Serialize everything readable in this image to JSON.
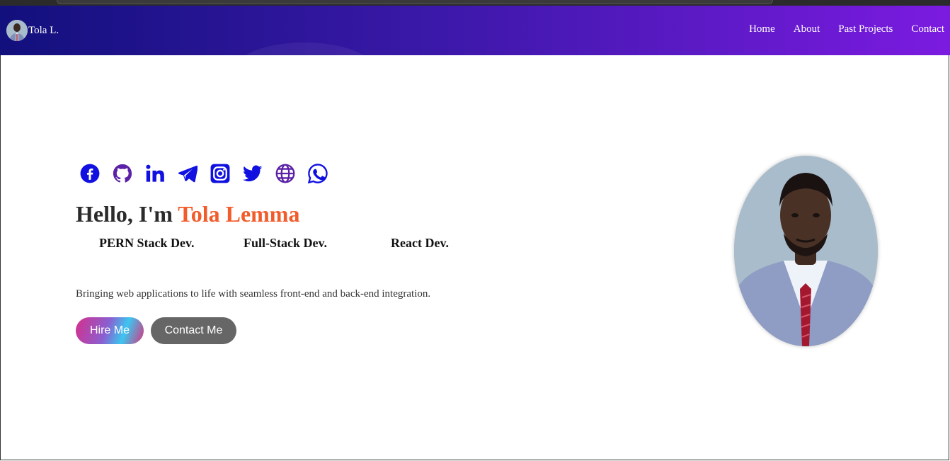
{
  "header": {
    "brand_name": "Tola L.",
    "nav": [
      "Home",
      "About",
      "Past Projects",
      "Contact"
    ]
  },
  "hero": {
    "socials": [
      "facebook-icon",
      "github-icon",
      "linkedin-icon",
      "telegram-icon",
      "instagram-icon",
      "twitter-icon",
      "globe-icon",
      "whatsapp-icon"
    ],
    "greeting": "Hello, I'm ",
    "name": "Tola Lemma",
    "roles": [
      "PERN Stack Dev.",
      "Full-Stack Dev.",
      "React Dev."
    ],
    "tagline": "Bringing web applications to life with seamless front-end and back-end integration.",
    "hire_label": "Hire Me",
    "contact_label": "Contact Me"
  },
  "colors": {
    "accent": "#f25c2b",
    "icon_blue": "#1010e0",
    "icon_purple": "#5b21a6",
    "nav_start": "#12107d",
    "nav_end": "#7b1be0",
    "contact_button": "#666666"
  }
}
